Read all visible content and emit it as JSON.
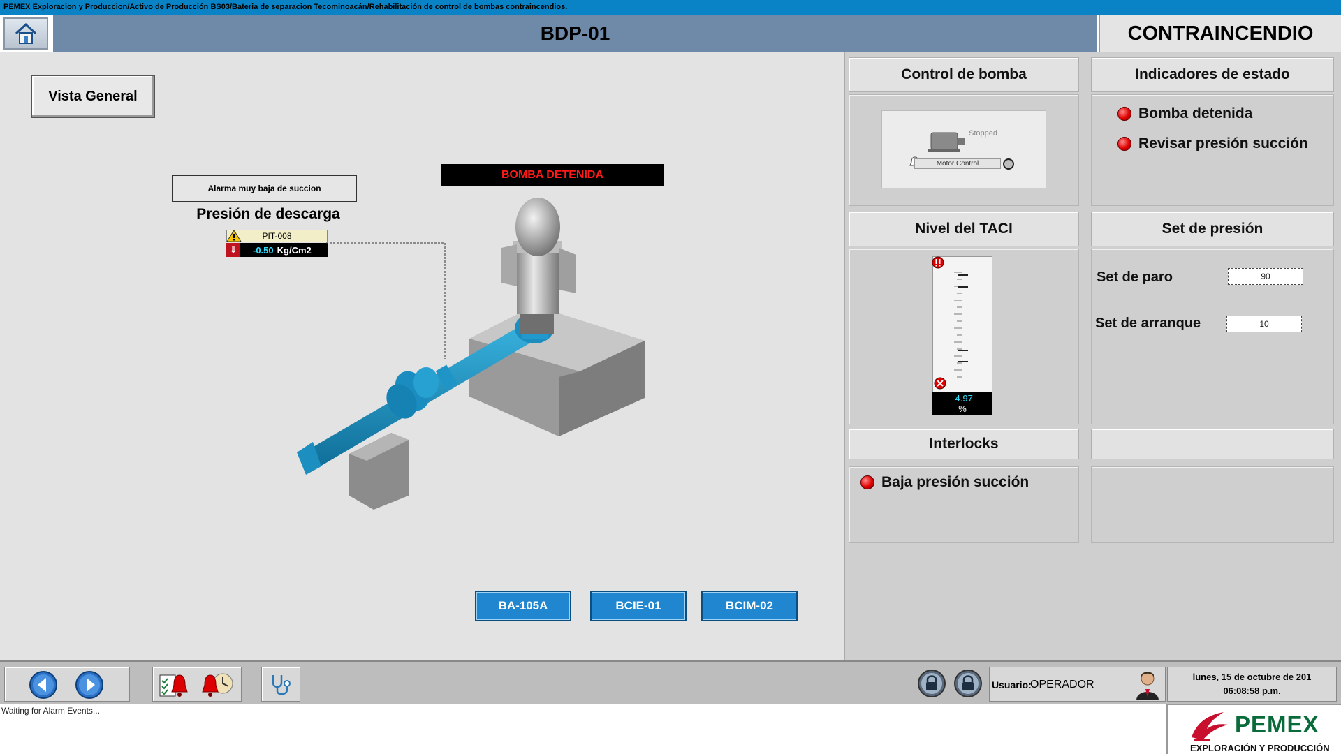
{
  "window": {
    "breadcrumb": "PEMEX Exploracion y Produccion/Activo de Producción BS03/Bateria de separacion Tecominoacán/Rehabilitación de control de bombas contraincendios."
  },
  "header": {
    "title": "BDP-01",
    "section": "CONTRAINCENDIO",
    "home_icon": "home-icon"
  },
  "main": {
    "vista_general_label": "Vista General",
    "alarm_label": "Alarma muy baja de succion",
    "pressure_title": "Presión de descarga",
    "pit": {
      "tag": "PIT-008",
      "value": "-0.50",
      "unit": "Kg/Cm2"
    },
    "status_banner": "BOMBA DETENIDA",
    "nav_buttons": [
      "BA-105A",
      "BCIE-01",
      "BCIM-02"
    ]
  },
  "right": {
    "pump_control": {
      "title": "Control de bomba",
      "motor_state": "Stopped",
      "motor_label": "Motor Control"
    },
    "status_indicators": {
      "title": "Indicadores de estado",
      "items": [
        "Bomba detenida",
        "Revisar presión succión"
      ]
    },
    "taci_level": {
      "title": "Nivel del TACI",
      "value": "-4.97",
      "unit": "%"
    },
    "pressure_set": {
      "title": "Set de presión",
      "stop_label": "Set de paro",
      "stop_value": "90",
      "start_label": "Set de arranque",
      "start_value": "10"
    },
    "interlocks": {
      "title": "Interlocks",
      "items": [
        "Baja presión succión"
      ]
    }
  },
  "toolbar": {
    "user_label": "Usuario:",
    "user_name": "OPERADOR",
    "date": "lunes, 15 de octubre de 201",
    "time": "06:08:58 p.m."
  },
  "status_strip": {
    "message": "Waiting for Alarm Events..."
  },
  "logo": {
    "brand": "PEMEX",
    "subtitle": "EXPLORACIÓN Y PRODUCCIÓN"
  },
  "colors": {
    "accent": "#1f86cf",
    "header_bar": "#6e8aa8",
    "alarm_red": "#e00000",
    "value_cyan": "#2fe0ff",
    "title_bar": "#0a83c6",
    "pemex_green": "#0a6b3a",
    "pemex_red": "#c8102e"
  }
}
